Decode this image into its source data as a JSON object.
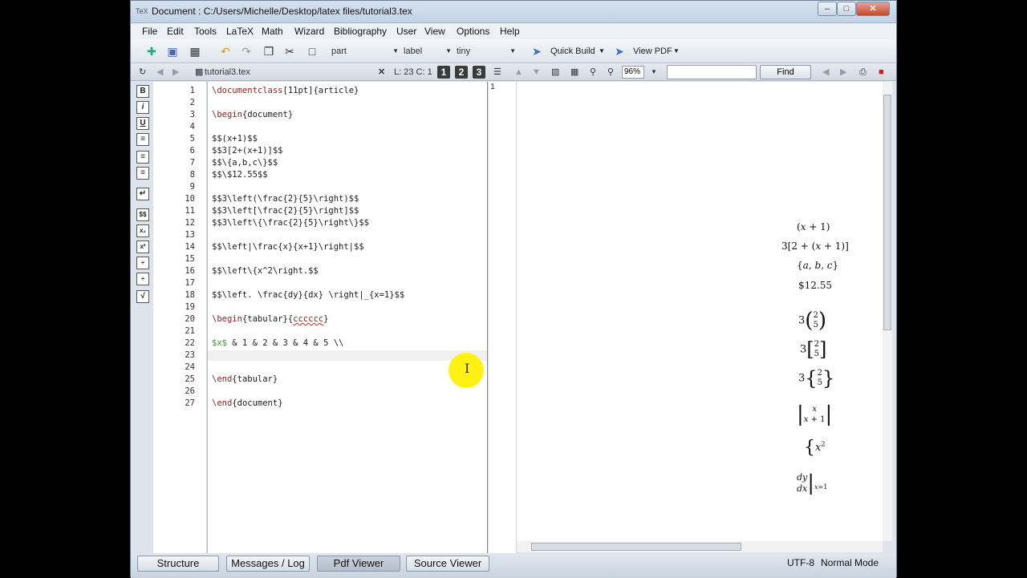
{
  "window": {
    "title": "Document : C:/Users/Michelle/Desktop/latex files/tutorial3.tex",
    "app_icon": "TeX"
  },
  "menu": [
    "File",
    "Edit",
    "Tools",
    "LaTeX",
    "Math",
    "Wizard",
    "Bibliography",
    "User",
    "View",
    "Options",
    "Help"
  ],
  "toolbar": {
    "combo_part": "part",
    "combo_label": "label",
    "combo_size": "tiny",
    "quick_build": "Quick Build",
    "view_pdf": "View PDF"
  },
  "subbar": {
    "filename": "tutorial3.tex",
    "position": "L: 23 C: 1",
    "num1": "1",
    "num2": "2",
    "num3": "3",
    "zoom": "96%",
    "find": "Find"
  },
  "editor": {
    "line_numbers": [
      "1",
      "2",
      "3",
      "4",
      "5",
      "6",
      "7",
      "8",
      "9",
      "10",
      "11",
      "12",
      "13",
      "14",
      "15",
      "16",
      "17",
      "18",
      "19",
      "20",
      "21",
      "22",
      "23",
      "24",
      "25",
      "26",
      "27"
    ]
  },
  "pdf": {
    "page_num": "1"
  },
  "bottom": {
    "tabs": [
      "Structure",
      "Messages / Log",
      "Pdf Viewer",
      "Source Viewer"
    ],
    "encoding": "UTF-8",
    "mode": "Normal Mode"
  },
  "colors": {
    "keyword": "#8b1f1f",
    "math": "#3e8e2d",
    "highlight": "#fff212"
  }
}
